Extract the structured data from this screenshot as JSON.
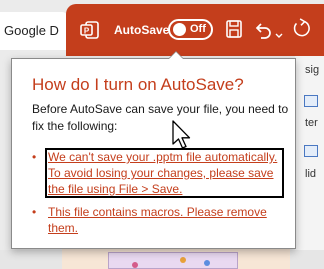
{
  "browser": {
    "tab_title": "Google D"
  },
  "titlebar": {
    "autosave_label": "AutoSave",
    "toggle_state": "Off",
    "accent_color": "#c43e1c",
    "icons": [
      "app-icon",
      "save-icon",
      "undo-icon",
      "chevron-down-icon",
      "redo-icon"
    ]
  },
  "popup": {
    "title": "How do I turn on AutoSave?",
    "description": "Before AutoSave can save your file, you need to fix the following:",
    "issues": [
      {
        "bullet": "•",
        "text": "We can't save your .pptm file automatically.\nTo avoid losing your changes, please save\nthe file using File > Save."
      },
      {
        "bullet": "•",
        "text": "This file contains macros. Please remove\nthem."
      }
    ]
  },
  "right_panel": {
    "labels": [
      "sig",
      "ter",
      "rm",
      "lid"
    ]
  }
}
